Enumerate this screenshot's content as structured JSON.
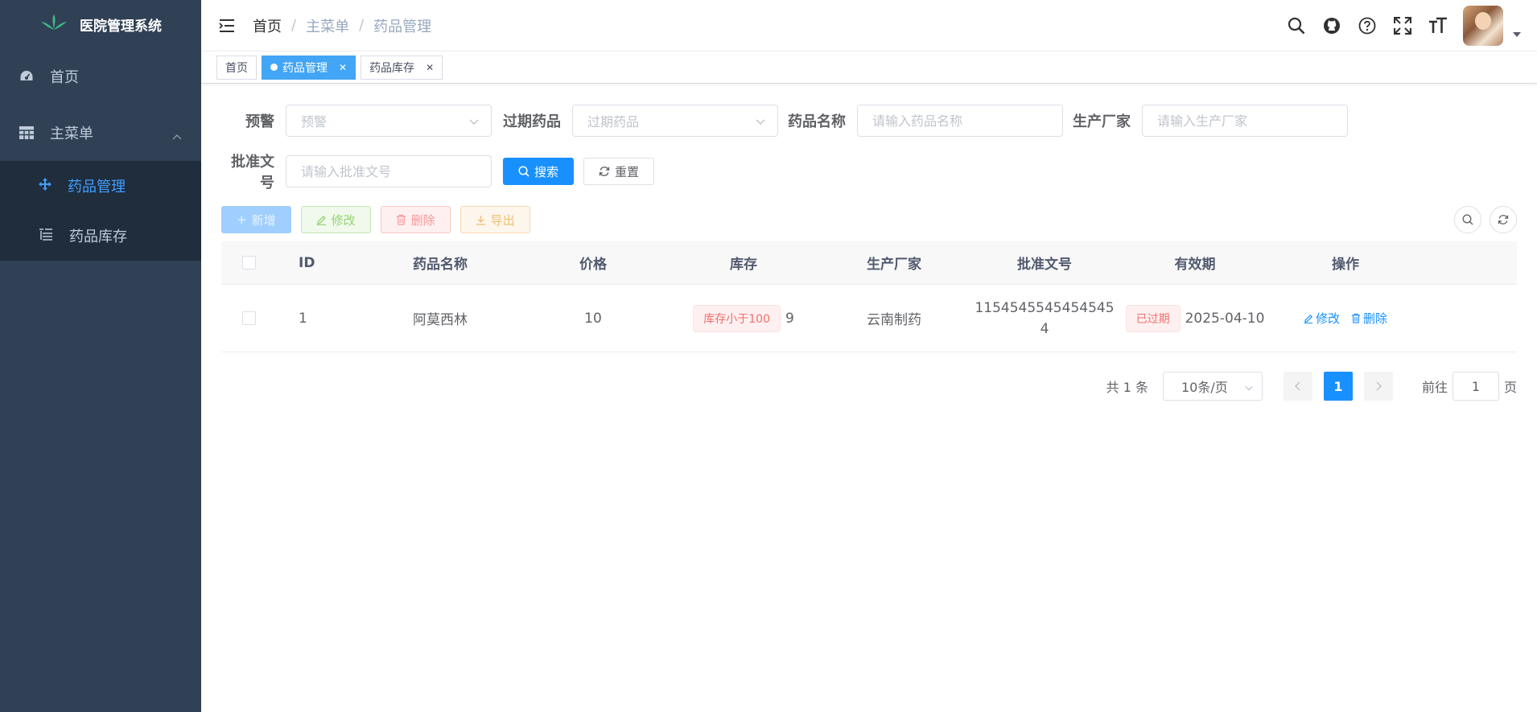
{
  "app": {
    "title": "医院管理系统"
  },
  "sidebar": {
    "home_label": "首页",
    "menu_label": "主菜单",
    "sub_items": [
      {
        "label": "药品管理",
        "active": true
      },
      {
        "label": "药品库存",
        "active": false
      }
    ]
  },
  "breadcrumb": [
    "首页",
    "主菜单",
    "药品管理"
  ],
  "tags": [
    {
      "label": "首页",
      "active": false,
      "closable": false
    },
    {
      "label": "药品管理",
      "active": true,
      "closable": true
    },
    {
      "label": "药品库存",
      "active": false,
      "closable": true
    }
  ],
  "filters": {
    "warning_label": "预警",
    "warning_placeholder": "预警",
    "expired_label": "过期药品",
    "expired_placeholder": "过期药品",
    "name_label": "药品名称",
    "name_placeholder": "请输入药品名称",
    "maker_label": "生产厂家",
    "maker_placeholder": "请输入生产厂家",
    "approval_label": "批准文号",
    "approval_placeholder": "请输入批准文号",
    "search_button": "搜索",
    "reset_button": "重置"
  },
  "toolbar": {
    "add_label": "新增",
    "edit_label": "修改",
    "delete_label": "删除",
    "export_label": "导出"
  },
  "table": {
    "headers": [
      "ID",
      "药品名称",
      "价格",
      "库存",
      "生产厂家",
      "批准文号",
      "有效期",
      "操作"
    ],
    "rows": [
      {
        "id": "1",
        "name": "阿莫西林",
        "price": "10",
        "stock_badge": "库存小于100",
        "stock": "9",
        "maker": "云南制药",
        "approval_line1": "1154545545454545",
        "approval_line2": "4",
        "expiry_badge": "已过期",
        "expiry": "2025-04-10",
        "edit_label": "修改",
        "delete_label": "删除"
      }
    ]
  },
  "pagination": {
    "total_text": "共 1 条",
    "page_size": "10条/页",
    "current_page": "1",
    "goto_label": "前往",
    "goto_value": "1",
    "page_unit": "页"
  },
  "colors": {
    "sidebar_bg": "#304156",
    "primary": "#1890ff",
    "danger": "#f56c6c"
  }
}
